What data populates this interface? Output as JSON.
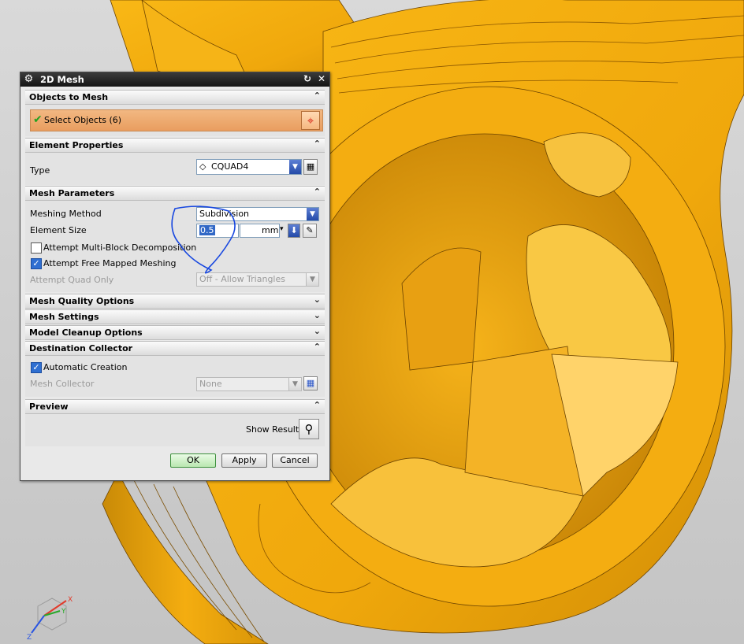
{
  "dialog": {
    "title": "2D Mesh",
    "sections": {
      "objects_to_mesh": {
        "header": "Objects to Mesh",
        "select_label": "Select Objects (6)"
      },
      "element_properties": {
        "header": "Element Properties",
        "type_label": "Type",
        "type_value": "CQUAD4"
      },
      "mesh_parameters": {
        "header": "Mesh Parameters",
        "meshing_method_label": "Meshing Method",
        "meshing_method_value": "Subdivision",
        "element_size_label": "Element Size",
        "element_size_value": "0.5",
        "element_size_unit": "mm",
        "multi_block_label": "Attempt Multi-Block Decomposition",
        "multi_block_checked": false,
        "free_mapped_label": "Attempt Free Mapped Meshing",
        "free_mapped_checked": true,
        "quad_only_label": "Attempt Quad Only",
        "quad_only_value": "Off - Allow Triangles"
      },
      "mesh_quality_options": {
        "header": "Mesh Quality Options"
      },
      "mesh_settings": {
        "header": "Mesh Settings"
      },
      "model_cleanup_options": {
        "header": "Model Cleanup Options"
      },
      "destination_collector": {
        "header": "Destination Collector",
        "automatic_creation_label": "Automatic Creation",
        "automatic_creation_checked": true,
        "mesh_collector_label": "Mesh Collector",
        "mesh_collector_value": "None"
      },
      "preview": {
        "header": "Preview",
        "show_result_label": "Show Result"
      }
    },
    "buttons": {
      "ok": "OK",
      "apply": "Apply",
      "cancel": "Cancel"
    }
  },
  "triad": {
    "x_label": "X",
    "y_label": "Y",
    "z_label": "Z"
  },
  "colors": {
    "part": "#f7b10f",
    "part_dark": "#b87a06",
    "background": "#cfcfcf",
    "annotation": "#1747e0"
  }
}
